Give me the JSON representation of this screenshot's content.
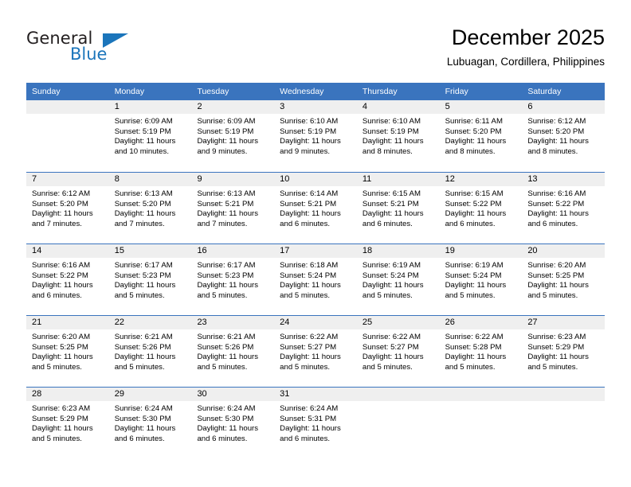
{
  "logo": {
    "word1": "General",
    "word2": "Blue",
    "triangle_color": "#1b75bb"
  },
  "header": {
    "title": "December 2025",
    "subtitle": "Lubuagan, Cordillera, Philippines"
  },
  "theme": {
    "header_blue": "#3a74be",
    "daynum_band": "#efefef",
    "cell_background": "#ffffff",
    "text_color": "#000000"
  },
  "weekdays": [
    "Sunday",
    "Monday",
    "Tuesday",
    "Wednesday",
    "Thursday",
    "Friday",
    "Saturday"
  ],
  "weeks": [
    [
      {
        "day": "",
        "sunrise": "",
        "sunset": "",
        "daylight1": "",
        "daylight2": ""
      },
      {
        "day": "1",
        "sunrise": "Sunrise: 6:09 AM",
        "sunset": "Sunset: 5:19 PM",
        "daylight1": "Daylight: 11 hours",
        "daylight2": "and 10 minutes."
      },
      {
        "day": "2",
        "sunrise": "Sunrise: 6:09 AM",
        "sunset": "Sunset: 5:19 PM",
        "daylight1": "Daylight: 11 hours",
        "daylight2": "and 9 minutes."
      },
      {
        "day": "3",
        "sunrise": "Sunrise: 6:10 AM",
        "sunset": "Sunset: 5:19 PM",
        "daylight1": "Daylight: 11 hours",
        "daylight2": "and 9 minutes."
      },
      {
        "day": "4",
        "sunrise": "Sunrise: 6:10 AM",
        "sunset": "Sunset: 5:19 PM",
        "daylight1": "Daylight: 11 hours",
        "daylight2": "and 8 minutes."
      },
      {
        "day": "5",
        "sunrise": "Sunrise: 6:11 AM",
        "sunset": "Sunset: 5:20 PM",
        "daylight1": "Daylight: 11 hours",
        "daylight2": "and 8 minutes."
      },
      {
        "day": "6",
        "sunrise": "Sunrise: 6:12 AM",
        "sunset": "Sunset: 5:20 PM",
        "daylight1": "Daylight: 11 hours",
        "daylight2": "and 8 minutes."
      }
    ],
    [
      {
        "day": "7",
        "sunrise": "Sunrise: 6:12 AM",
        "sunset": "Sunset: 5:20 PM",
        "daylight1": "Daylight: 11 hours",
        "daylight2": "and 7 minutes."
      },
      {
        "day": "8",
        "sunrise": "Sunrise: 6:13 AM",
        "sunset": "Sunset: 5:20 PM",
        "daylight1": "Daylight: 11 hours",
        "daylight2": "and 7 minutes."
      },
      {
        "day": "9",
        "sunrise": "Sunrise: 6:13 AM",
        "sunset": "Sunset: 5:21 PM",
        "daylight1": "Daylight: 11 hours",
        "daylight2": "and 7 minutes."
      },
      {
        "day": "10",
        "sunrise": "Sunrise: 6:14 AM",
        "sunset": "Sunset: 5:21 PM",
        "daylight1": "Daylight: 11 hours",
        "daylight2": "and 6 minutes."
      },
      {
        "day": "11",
        "sunrise": "Sunrise: 6:15 AM",
        "sunset": "Sunset: 5:21 PM",
        "daylight1": "Daylight: 11 hours",
        "daylight2": "and 6 minutes."
      },
      {
        "day": "12",
        "sunrise": "Sunrise: 6:15 AM",
        "sunset": "Sunset: 5:22 PM",
        "daylight1": "Daylight: 11 hours",
        "daylight2": "and 6 minutes."
      },
      {
        "day": "13",
        "sunrise": "Sunrise: 6:16 AM",
        "sunset": "Sunset: 5:22 PM",
        "daylight1": "Daylight: 11 hours",
        "daylight2": "and 6 minutes."
      }
    ],
    [
      {
        "day": "14",
        "sunrise": "Sunrise: 6:16 AM",
        "sunset": "Sunset: 5:22 PM",
        "daylight1": "Daylight: 11 hours",
        "daylight2": "and 6 minutes."
      },
      {
        "day": "15",
        "sunrise": "Sunrise: 6:17 AM",
        "sunset": "Sunset: 5:23 PM",
        "daylight1": "Daylight: 11 hours",
        "daylight2": "and 5 minutes."
      },
      {
        "day": "16",
        "sunrise": "Sunrise: 6:17 AM",
        "sunset": "Sunset: 5:23 PM",
        "daylight1": "Daylight: 11 hours",
        "daylight2": "and 5 minutes."
      },
      {
        "day": "17",
        "sunrise": "Sunrise: 6:18 AM",
        "sunset": "Sunset: 5:24 PM",
        "daylight1": "Daylight: 11 hours",
        "daylight2": "and 5 minutes."
      },
      {
        "day": "18",
        "sunrise": "Sunrise: 6:19 AM",
        "sunset": "Sunset: 5:24 PM",
        "daylight1": "Daylight: 11 hours",
        "daylight2": "and 5 minutes."
      },
      {
        "day": "19",
        "sunrise": "Sunrise: 6:19 AM",
        "sunset": "Sunset: 5:24 PM",
        "daylight1": "Daylight: 11 hours",
        "daylight2": "and 5 minutes."
      },
      {
        "day": "20",
        "sunrise": "Sunrise: 6:20 AM",
        "sunset": "Sunset: 5:25 PM",
        "daylight1": "Daylight: 11 hours",
        "daylight2": "and 5 minutes."
      }
    ],
    [
      {
        "day": "21",
        "sunrise": "Sunrise: 6:20 AM",
        "sunset": "Sunset: 5:25 PM",
        "daylight1": "Daylight: 11 hours",
        "daylight2": "and 5 minutes."
      },
      {
        "day": "22",
        "sunrise": "Sunrise: 6:21 AM",
        "sunset": "Sunset: 5:26 PM",
        "daylight1": "Daylight: 11 hours",
        "daylight2": "and 5 minutes."
      },
      {
        "day": "23",
        "sunrise": "Sunrise: 6:21 AM",
        "sunset": "Sunset: 5:26 PM",
        "daylight1": "Daylight: 11 hours",
        "daylight2": "and 5 minutes."
      },
      {
        "day": "24",
        "sunrise": "Sunrise: 6:22 AM",
        "sunset": "Sunset: 5:27 PM",
        "daylight1": "Daylight: 11 hours",
        "daylight2": "and 5 minutes."
      },
      {
        "day": "25",
        "sunrise": "Sunrise: 6:22 AM",
        "sunset": "Sunset: 5:27 PM",
        "daylight1": "Daylight: 11 hours",
        "daylight2": "and 5 minutes."
      },
      {
        "day": "26",
        "sunrise": "Sunrise: 6:22 AM",
        "sunset": "Sunset: 5:28 PM",
        "daylight1": "Daylight: 11 hours",
        "daylight2": "and 5 minutes."
      },
      {
        "day": "27",
        "sunrise": "Sunrise: 6:23 AM",
        "sunset": "Sunset: 5:29 PM",
        "daylight1": "Daylight: 11 hours",
        "daylight2": "and 5 minutes."
      }
    ],
    [
      {
        "day": "28",
        "sunrise": "Sunrise: 6:23 AM",
        "sunset": "Sunset: 5:29 PM",
        "daylight1": "Daylight: 11 hours",
        "daylight2": "and 5 minutes."
      },
      {
        "day": "29",
        "sunrise": "Sunrise: 6:24 AM",
        "sunset": "Sunset: 5:30 PM",
        "daylight1": "Daylight: 11 hours",
        "daylight2": "and 6 minutes."
      },
      {
        "day": "30",
        "sunrise": "Sunrise: 6:24 AM",
        "sunset": "Sunset: 5:30 PM",
        "daylight1": "Daylight: 11 hours",
        "daylight2": "and 6 minutes."
      },
      {
        "day": "31",
        "sunrise": "Sunrise: 6:24 AM",
        "sunset": "Sunset: 5:31 PM",
        "daylight1": "Daylight: 11 hours",
        "daylight2": "and 6 minutes."
      },
      {
        "day": "",
        "sunrise": "",
        "sunset": "",
        "daylight1": "",
        "daylight2": ""
      },
      {
        "day": "",
        "sunrise": "",
        "sunset": "",
        "daylight1": "",
        "daylight2": ""
      },
      {
        "day": "",
        "sunrise": "",
        "sunset": "",
        "daylight1": "",
        "daylight2": ""
      }
    ]
  ]
}
